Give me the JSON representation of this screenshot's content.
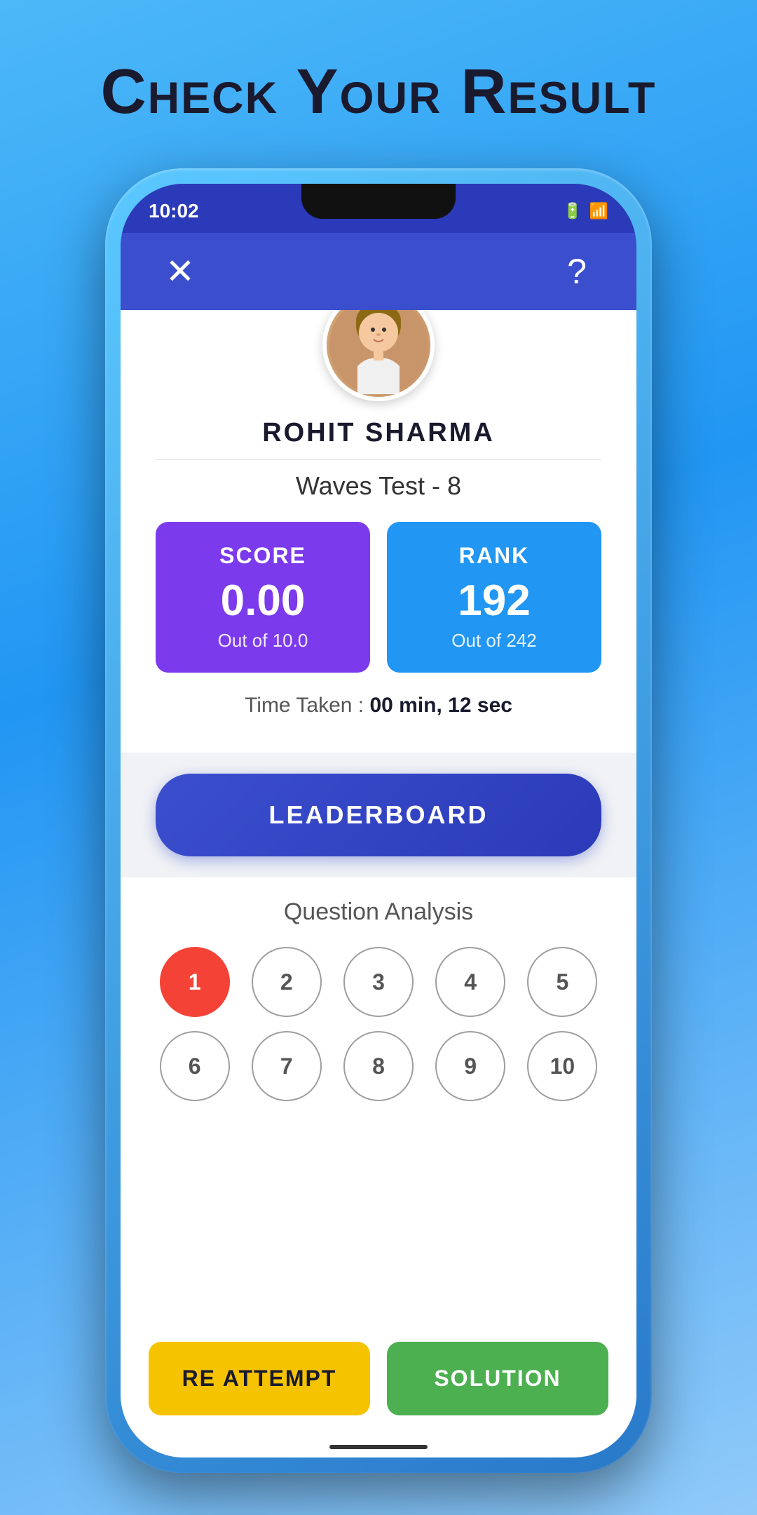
{
  "page": {
    "title": "Check Your Result",
    "background_color": "#4db8f8"
  },
  "status_bar": {
    "time": "10:02",
    "icons": [
      "signal",
      "lock",
      "wifi",
      "battery"
    ]
  },
  "nav": {
    "close_label": "✕",
    "help_label": "?"
  },
  "user": {
    "name": "ROHIT SHARMA",
    "avatar_alt": "Profile photo"
  },
  "test": {
    "name": "Waves Test - 8"
  },
  "score": {
    "label": "SCORE",
    "value": "0.00",
    "sub": "Out of 10.0"
  },
  "rank": {
    "label": "RANK",
    "value": "192",
    "sub": "Out of 242"
  },
  "time_taken": {
    "label": "Time Taken : ",
    "value": "00 min, 12 sec"
  },
  "leaderboard": {
    "label": "LEADERBOARD"
  },
  "analysis": {
    "title": "Question Analysis",
    "questions": [
      1,
      2,
      3,
      4,
      5,
      6,
      7,
      8,
      9,
      10
    ],
    "answered_wrong": [
      1
    ]
  },
  "buttons": {
    "reattempt": "RE ATTEMPT",
    "solution": "SOLUTION"
  }
}
